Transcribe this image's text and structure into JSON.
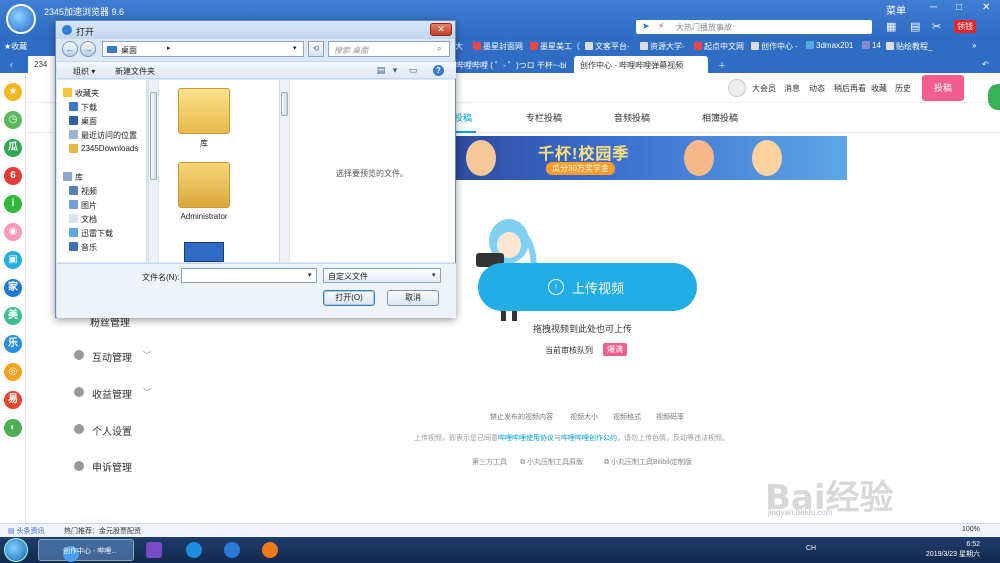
{
  "browser": {
    "title": "2345加速浏览器 9.6",
    "address_placeholder": "大热门播放事故",
    "steal": "领钱",
    "menu_icon": "menu-icon",
    "skin_label": "菜单"
  },
  "bookmarks": [
    {
      "label": "收藏"
    },
    {
      "label": "大"
    },
    {
      "label": "墨星封面网"
    },
    {
      "label": "墨星美工（"
    },
    {
      "label": "文客平台-"
    },
    {
      "label": "资源大学-"
    },
    {
      "label": "起点中文网"
    },
    {
      "label": "创作中心 -"
    },
    {
      "label": "3dmax201"
    },
    {
      "label": "14"
    },
    {
      "label": "贴绘教程_"
    }
  ],
  "tabs": [
    {
      "label": "234"
    },
    {
      "label": "哔哩哔哩 ( ゜- ゜)つロ 干杯~-bi"
    },
    {
      "label": "创作中心 - 哔哩哔哩弹幕视频"
    }
  ],
  "site_nav": {
    "links": [
      "大会员",
      "消息",
      "动态",
      "稍后再看",
      "收藏",
      "历史"
    ],
    "upload": "投稿"
  },
  "sub_tabs": [
    "投稿",
    "专栏投稿",
    "音频投稿",
    "相簿投稿"
  ],
  "banner": {
    "title": "千杯!校园季",
    "subtitle": "瓜分30万奖学金"
  },
  "upload": {
    "button": "上传视频",
    "drag_hint": "拖拽视频到此处也可上传",
    "queue_label": "当前审核队列",
    "queue_status": "爆满"
  },
  "bottom_links": [
    "禁止发布的视频内容",
    "视频大小",
    "视频格式",
    "视频码率"
  ],
  "agreement": {
    "prefix": "上传视频，即表示您已同意",
    "link1": "哔哩哔哩使用协议",
    "mid": "与",
    "link2": "哔哩哔哩创作公约",
    "suffix": "，请勿上传色情，反动等违法视频。"
  },
  "tools": [
    "第三方工具",
    "小丸压制工具原版",
    "小丸压制工具Bilibili定制版"
  ],
  "page_menu": [
    "粉丝管理",
    "互动管理",
    "收益管理",
    "个人设置",
    "申诉管理"
  ],
  "dialog": {
    "title": "打开",
    "path": "桌面",
    "search_placeholder": "搜索 桌面",
    "organize": "组织",
    "new_folder": "新建文件夹",
    "nav_items": [
      "收藏夹",
      "下载",
      "桌面",
      "最近访问的位置",
      "2345Downloads",
      "库",
      "视频",
      "图片",
      "文档",
      "迅雷下载",
      "音乐"
    ],
    "files": [
      "库",
      "Administrator"
    ],
    "preview_text": "选择要预览的文件。",
    "filename_label": "文件名(N):",
    "filename_value": "",
    "filter": "自定义文件",
    "open_button": "打开(O)",
    "cancel_button": "取消"
  },
  "status_bar": {
    "news": "头条资讯",
    "hot": "热门推荐：金元股票配资",
    "zoom": "100%"
  },
  "taskbar": {
    "browser_item": "创作中心 - 哔哩...",
    "time": "6:52",
    "date": "2019/3/23 星期六",
    "ime": "CH"
  },
  "watermark": {
    "text": "Bai经验",
    "sub": "jingyan.baidu.com"
  },
  "colors": {
    "accent": "#00a1d6",
    "brand_pink": "#f25d8e",
    "browser_blue": "#2f6cc4",
    "upload_blue": "#23ade5"
  }
}
